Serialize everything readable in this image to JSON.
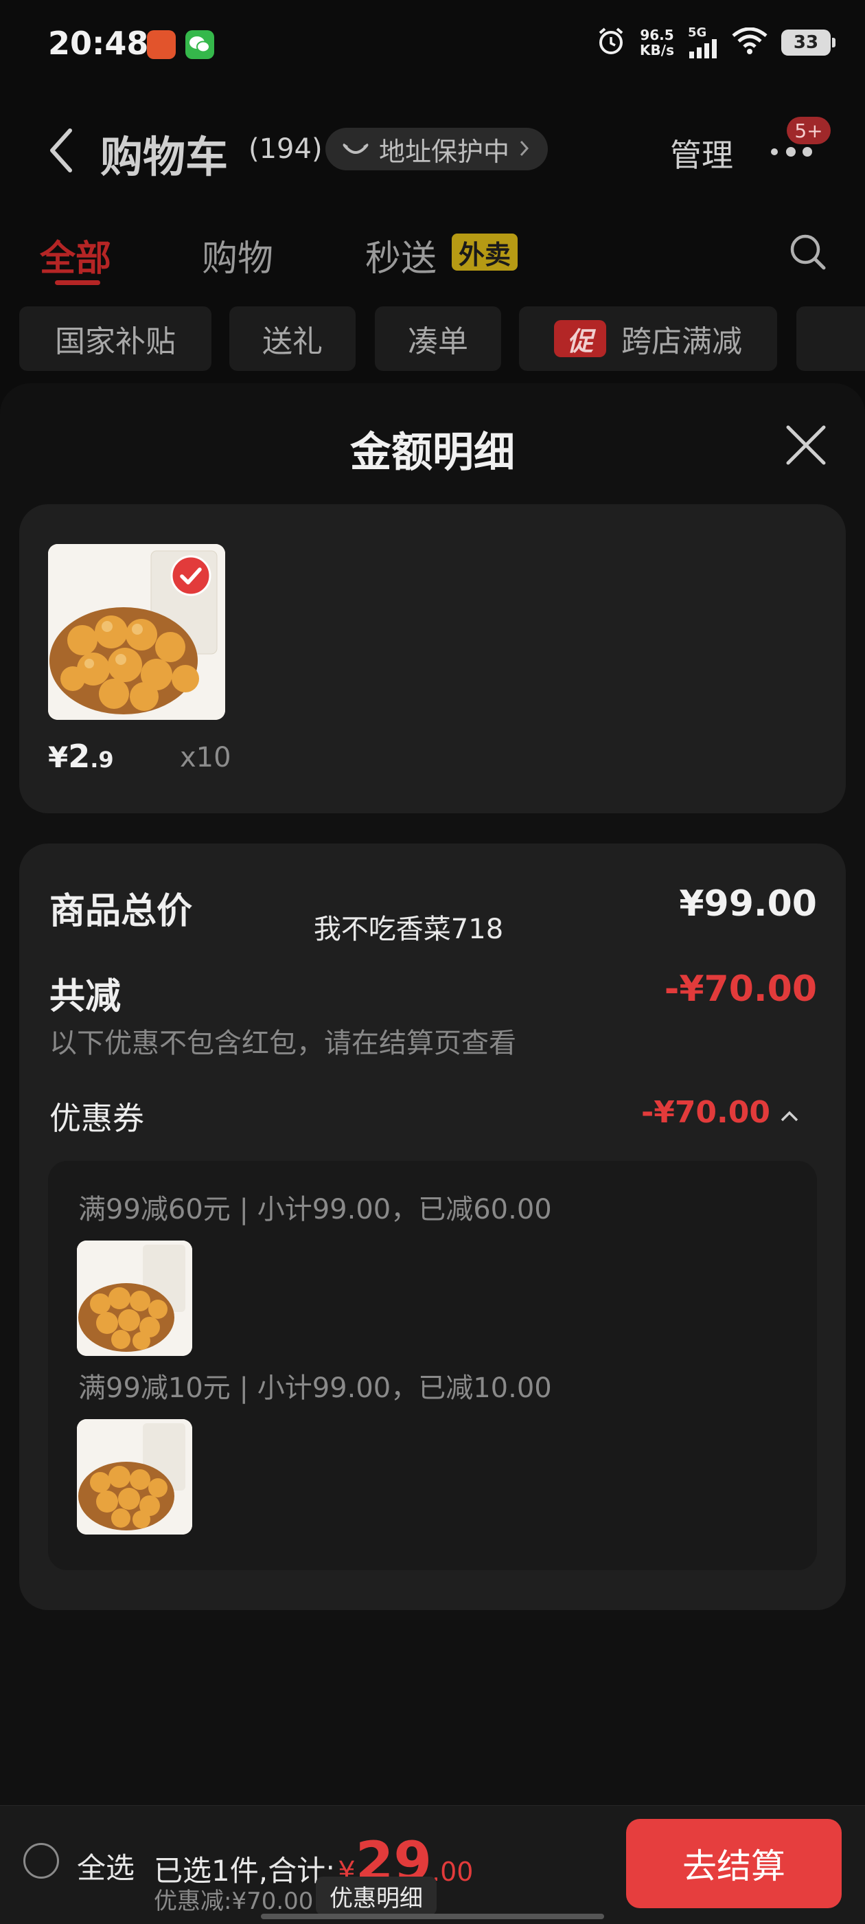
{
  "status_bar": {
    "time": "20:48",
    "net_speed_value": "96.5",
    "net_speed_unit": "KB/s",
    "signal": "5G",
    "battery": "33",
    "icons": [
      "alarm-icon",
      "signal-icon",
      "wifi-icon",
      "battery-icon"
    ]
  },
  "header": {
    "title": "购物车",
    "count": "(194)",
    "address_protect": "地址保护中",
    "manage": "管理",
    "more_badge": "5+"
  },
  "tabs": [
    {
      "label": "全部",
      "active": true
    },
    {
      "label": "购物",
      "active": false
    },
    {
      "label": "秒送",
      "active": false,
      "badge": "外卖"
    }
  ],
  "chips": [
    {
      "label": "国家补贴"
    },
    {
      "label": "送礼"
    },
    {
      "label": "凑单"
    },
    {
      "label": "跨店满减",
      "icon_text": "促"
    }
  ],
  "sheet": {
    "title": "金额明细",
    "item": {
      "price_symbol": "¥",
      "price_int": "2",
      "price_dec": ".9",
      "qty": "x10"
    },
    "summary": {
      "total_label": "商品总价",
      "total_value": "¥99.00",
      "watermark": "我不吃香菜718",
      "discount_label": "共减",
      "discount_value": "-¥70.00",
      "note": "以下优惠不包含红包，请在结算页查看",
      "coupon_label": "优惠券",
      "coupon_value": "-¥70.00",
      "coupons": [
        {
          "text": "满99减60元 | 小计99.00，已减60.00"
        },
        {
          "text": "满99减10元 | 小计99.00，已减10.00"
        }
      ]
    }
  },
  "bottom_bar": {
    "select_all": "全选",
    "selected_text": "已选1件,合计:",
    "total_symbol": "¥",
    "total_int": "29",
    "total_dec": ".00",
    "discount_text": "优惠减:¥70.00",
    "detail_button": "优惠明细",
    "checkout": "去结算"
  },
  "colors": {
    "accent_red": "#e63e3e",
    "tab_red": "#b52525",
    "background": "#0c0c0c",
    "card": "#1f1f1f"
  }
}
